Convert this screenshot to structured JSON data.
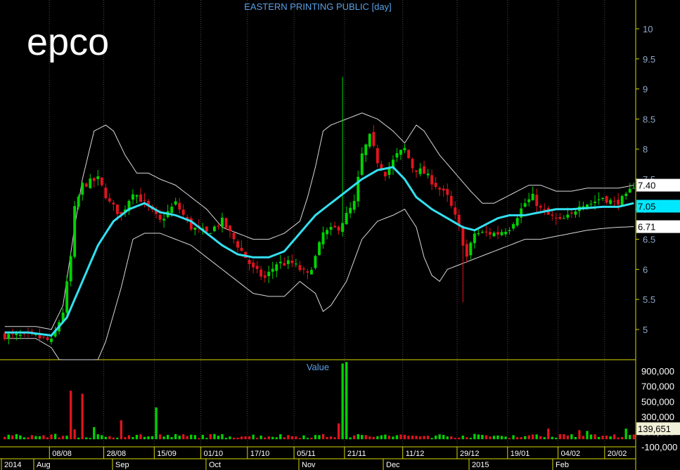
{
  "chart_data": [
    {
      "type": "candlestick",
      "title": "EASTERN PRINTING PUBLIC [day]",
      "watermark": "epco",
      "ylim": [
        4.6,
        10.4
      ],
      "y_ticks": [
        "10",
        "9.5",
        "9",
        "8.5",
        "8",
        "7.5",
        "7",
        "6.5",
        "6",
        "5.5",
        "5"
      ],
      "x_ticks": [
        "08/08",
        "28/08",
        "15/09",
        "01/10",
        "17/10",
        "05/11",
        "21/11",
        "11/12",
        "29/12",
        "19/01",
        "04/02",
        "20/02"
      ],
      "x_major": [
        "2014",
        "Aug",
        "Sep",
        "Oct",
        "Nov",
        "Dec",
        "2015",
        "Feb"
      ],
      "price_tags": [
        "7.40",
        "7.05",
        "6.71"
      ],
      "series": [
        {
          "name": "Price",
          "kind": "candles",
          "keypoints": [
            [
              0,
              4.9
            ],
            [
              8,
              4.88
            ],
            [
              12,
              4.8
            ],
            [
              15,
              5.3
            ],
            [
              17,
              6.2
            ],
            [
              18,
              7.0
            ],
            [
              20,
              7.4
            ],
            [
              24,
              7.5
            ],
            [
              27,
              7.1
            ],
            [
              30,
              6.9
            ],
            [
              33,
              7.3
            ],
            [
              36,
              7.1
            ],
            [
              40,
              6.8
            ],
            [
              44,
              7.1
            ],
            [
              48,
              6.7
            ],
            [
              52,
              6.6
            ],
            [
              56,
              6.8
            ],
            [
              60,
              6.4
            ],
            [
              64,
              6.0
            ],
            [
              67,
              5.85
            ],
            [
              70,
              6.1
            ],
            [
              74,
              6.1
            ],
            [
              78,
              5.9
            ],
            [
              80,
              6.2
            ],
            [
              82,
              6.6
            ],
            [
              86,
              6.7
            ],
            [
              88,
              6.9
            ],
            [
              90,
              7.1
            ],
            [
              92,
              7.9
            ],
            [
              94,
              8.2
            ],
            [
              96,
              7.8
            ],
            [
              98,
              7.6
            ],
            [
              101,
              7.9
            ],
            [
              103,
              8.0
            ],
            [
              105,
              7.7
            ],
            [
              108,
              7.6
            ],
            [
              111,
              7.4
            ],
            [
              114,
              7.2
            ],
            [
              117,
              6.7
            ],
            [
              119,
              6.2
            ],
            [
              121,
              6.6
            ],
            [
              124,
              6.6
            ],
            [
              127,
              6.6
            ],
            [
              130,
              6.7
            ],
            [
              132,
              6.9
            ],
            [
              134,
              7.1
            ],
            [
              136,
              7.2
            ],
            [
              138,
              7.0
            ],
            [
              140,
              6.9
            ],
            [
              143,
              6.8
            ],
            [
              146,
              6.9
            ],
            [
              148,
              7.1
            ],
            [
              151,
              7.1
            ],
            [
              154,
              7.2
            ],
            [
              157,
              7.1
            ],
            [
              160,
              7.2
            ],
            [
              162,
              7.4
            ]
          ],
          "color_up": "#00d400",
          "color_down": "#e0141e"
        },
        {
          "name": "MA",
          "color": "#33e0f0",
          "keypoints": [
            [
              0,
              4.95
            ],
            [
              6,
              4.95
            ],
            [
              12,
              4.9
            ],
            [
              16,
              5.2
            ],
            [
              20,
              5.8
            ],
            [
              24,
              6.4
            ],
            [
              28,
              6.8
            ],
            [
              32,
              7.0
            ],
            [
              36,
              7.1
            ],
            [
              40,
              6.95
            ],
            [
              44,
              6.9
            ],
            [
              48,
              6.8
            ],
            [
              52,
              6.6
            ],
            [
              56,
              6.4
            ],
            [
              60,
              6.25
            ],
            [
              64,
              6.2
            ],
            [
              68,
              6.2
            ],
            [
              72,
              6.3
            ],
            [
              76,
              6.6
            ],
            [
              80,
              6.9
            ],
            [
              84,
              7.1
            ],
            [
              88,
              7.3
            ],
            [
              92,
              7.5
            ],
            [
              96,
              7.65
            ],
            [
              100,
              7.7
            ],
            [
              103,
              7.5
            ],
            [
              106,
              7.2
            ],
            [
              110,
              7.0
            ],
            [
              114,
              6.85
            ],
            [
              118,
              6.7
            ],
            [
              121,
              6.65
            ],
            [
              124,
              6.75
            ],
            [
              127,
              6.85
            ],
            [
              130,
              6.9
            ],
            [
              134,
              6.9
            ],
            [
              138,
              6.95
            ],
            [
              142,
              7.0
            ],
            [
              146,
              7.0
            ],
            [
              150,
              7.02
            ],
            [
              154,
              7.04
            ],
            [
              158,
              7.04
            ],
            [
              162,
              7.1
            ]
          ]
        },
        {
          "name": "Upper Band",
          "color": "#d8d8d8",
          "keypoints": [
            [
              0,
              5.05
            ],
            [
              8,
              5.05
            ],
            [
              12,
              5.0
            ],
            [
              15,
              5.4
            ],
            [
              18,
              6.7
            ],
            [
              20,
              7.5
            ],
            [
              23,
              8.3
            ],
            [
              26,
              8.4
            ],
            [
              28,
              8.3
            ],
            [
              31,
              7.9
            ],
            [
              34,
              7.6
            ],
            [
              37,
              7.6
            ],
            [
              40,
              7.5
            ],
            [
              44,
              7.4
            ],
            [
              48,
              7.2
            ],
            [
              52,
              7.0
            ],
            [
              56,
              6.7
            ],
            [
              60,
              6.6
            ],
            [
              64,
              6.5
            ],
            [
              68,
              6.5
            ],
            [
              72,
              6.6
            ],
            [
              76,
              6.8
            ],
            [
              78,
              7.2
            ],
            [
              80,
              7.7
            ],
            [
              82,
              8.3
            ],
            [
              84,
              8.4
            ],
            [
              88,
              8.5
            ],
            [
              92,
              8.6
            ],
            [
              96,
              8.5
            ],
            [
              100,
              8.3
            ],
            [
              103,
              8.1
            ],
            [
              106,
              8.4
            ],
            [
              108,
              8.3
            ],
            [
              112,
              7.9
            ],
            [
              116,
              7.6
            ],
            [
              120,
              7.3
            ],
            [
              123,
              7.1
            ],
            [
              126,
              7.1
            ],
            [
              129,
              7.2
            ],
            [
              132,
              7.3
            ],
            [
              135,
              7.4
            ],
            [
              138,
              7.4
            ],
            [
              142,
              7.3
            ],
            [
              146,
              7.3
            ],
            [
              150,
              7.35
            ],
            [
              154,
              7.35
            ],
            [
              158,
              7.35
            ],
            [
              162,
              7.4
            ]
          ]
        },
        {
          "name": "Lower Band",
          "color": "#d8d8d8",
          "keypoints": [
            [
              0,
              4.85
            ],
            [
              8,
              4.85
            ],
            [
              12,
              4.7
            ],
            [
              14,
              4.5
            ],
            [
              18,
              3.5
            ],
            [
              22,
              4.2
            ],
            [
              26,
              4.8
            ],
            [
              30,
              5.7
            ],
            [
              33,
              6.5
            ],
            [
              36,
              6.6
            ],
            [
              40,
              6.6
            ],
            [
              44,
              6.5
            ],
            [
              48,
              6.4
            ],
            [
              52,
              6.2
            ],
            [
              56,
              6.0
            ],
            [
              60,
              5.8
            ],
            [
              64,
              5.6
            ],
            [
              68,
              5.55
            ],
            [
              72,
              5.55
            ],
            [
              76,
              5.8
            ],
            [
              80,
              5.6
            ],
            [
              82,
              5.3
            ],
            [
              84,
              5.4
            ],
            [
              88,
              5.8
            ],
            [
              92,
              6.5
            ],
            [
              96,
              6.8
            ],
            [
              100,
              6.9
            ],
            [
              103,
              7.0
            ],
            [
              106,
              6.7
            ],
            [
              108,
              6.2
            ],
            [
              110,
              5.9
            ],
            [
              112,
              5.8
            ],
            [
              114,
              6.0
            ],
            [
              118,
              6.1
            ],
            [
              122,
              6.2
            ],
            [
              126,
              6.3
            ],
            [
              130,
              6.4
            ],
            [
              134,
              6.5
            ],
            [
              138,
              6.5
            ],
            [
              142,
              6.55
            ],
            [
              146,
              6.6
            ],
            [
              150,
              6.65
            ],
            [
              154,
              6.68
            ],
            [
              158,
              6.7
            ],
            [
              162,
              6.71
            ]
          ]
        }
      ]
    },
    {
      "type": "bar",
      "label": "Value",
      "y_ticks": [
        "900,000",
        "700,000",
        "500,000",
        "300,000",
        "100,000",
        "-100,000"
      ],
      "ylim": [
        -100000,
        1050000
      ],
      "last_value": "139,651",
      "spikes": [
        [
          17,
          640000
        ],
        [
          20,
          600000
        ],
        [
          30,
          250000
        ],
        [
          39,
          420000
        ],
        [
          87,
          1000000
        ],
        [
          88,
          1020000
        ],
        [
          86,
          210000
        ],
        [
          18,
          130000
        ],
        [
          23,
          160000
        ],
        [
          140,
          140000
        ],
        [
          148,
          120000
        ],
        [
          150,
          110000
        ],
        [
          160,
          140000
        ]
      ],
      "base_level": 40000,
      "color_up": "#00d400",
      "color_down": "#e0141e"
    }
  ]
}
